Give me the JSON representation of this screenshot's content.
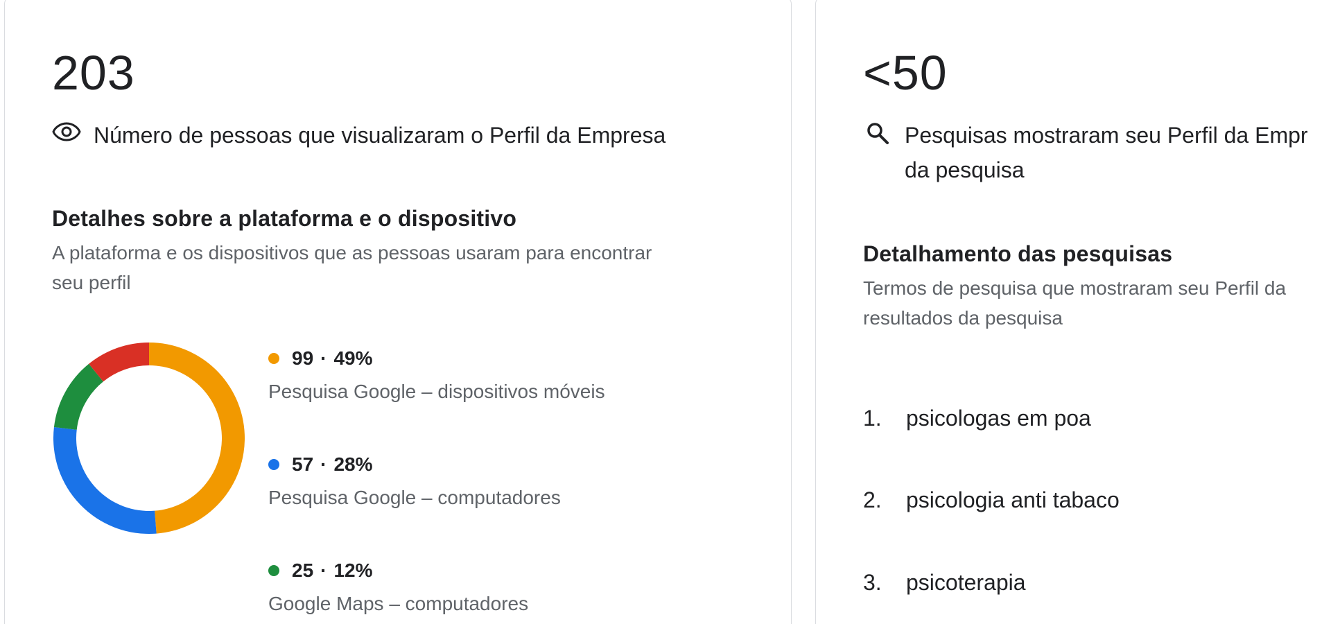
{
  "left_card": {
    "total": "203",
    "headline": "Número de pessoas que visualizaram o Perfil da Empresa",
    "icon": "eye-icon",
    "section_title": "Detalhes sobre a plataforma e o dispositivo",
    "section_desc_line1": "A plataforma e os dispositivos que as pessoas usaram para encontrar",
    "section_desc_line2": "seu perfil",
    "legend": [
      {
        "value": "99",
        "percent": "49%",
        "label": "Pesquisa Google – dispositivos móveis",
        "color": "#f29900"
      },
      {
        "value": "57",
        "percent": "28%",
        "label": "Pesquisa Google – computadores",
        "color": "#1a73e8"
      },
      {
        "value": "25",
        "percent": "12%",
        "label": "Google Maps – computadores",
        "color": "#1e8e3e"
      }
    ],
    "separator": "·"
  },
  "chart_data": {
    "type": "pie",
    "style": "donut",
    "slices": [
      {
        "label": "Pesquisa Google – dispositivos móveis",
        "value": 99,
        "percent": 49,
        "color": "#f29900"
      },
      {
        "label": "Pesquisa Google – computadores",
        "value": 57,
        "percent": 28,
        "color": "#1a73e8"
      },
      {
        "label": "Google Maps – computadores",
        "value": 25,
        "percent": 12,
        "color": "#1e8e3e"
      },
      {
        "label": "",
        "value": 22,
        "percent": 11,
        "color": "#d93025"
      }
    ]
  },
  "right_card": {
    "total": "<50",
    "icon": "search-icon",
    "headline_line1": "Pesquisas mostraram seu Perfil da Empr",
    "headline_line2": "da pesquisa",
    "section_title": "Detalhamento das pesquisas",
    "section_desc_line1": "Termos de pesquisa que mostraram seu Perfil da",
    "section_desc_line2": "resultados da pesquisa",
    "searches": [
      {
        "num": "1.",
        "term": "psicologas em poa"
      },
      {
        "num": "2.",
        "term": "psicologia anti tabaco"
      },
      {
        "num": "3.",
        "term": "psicoterapia"
      }
    ]
  }
}
